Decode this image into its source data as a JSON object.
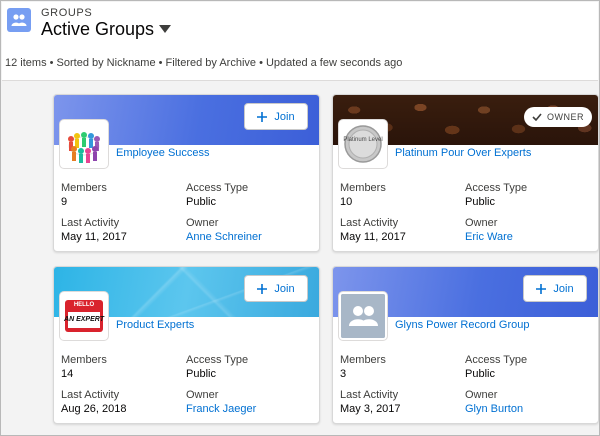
{
  "header": {
    "object_label": "GROUPS",
    "list_title": "Active Groups",
    "meta": "12 items • Sorted by Nickname • Filtered by Archive • Updated a few seconds ago"
  },
  "labels": {
    "members": "Members",
    "access_type": "Access Type",
    "last_activity": "Last Activity",
    "owner": "Owner",
    "join": "Join",
    "owner_badge": "OWNER"
  },
  "cards": [
    {
      "name": "Employee Success",
      "members": "9",
      "access_type": "Public",
      "last_activity": "May 11, 2017",
      "owner": "Anne Schreiner",
      "banner": "blue",
      "action": "join",
      "avatar_icon": "people-circle-image"
    },
    {
      "name": "Platinum Pour Over Experts",
      "members": "10",
      "access_type": "Public",
      "last_activity": "May 11, 2017",
      "owner": "Eric Ware",
      "banner": "coffee",
      "action": "owner",
      "avatar_icon": "platinum-level-medal-image",
      "avatar_text": "Platinum Level"
    },
    {
      "name": "Product Experts",
      "members": "14",
      "access_type": "Public",
      "last_activity": "Aug 26, 2018",
      "owner": "Franck Jaeger",
      "banner": "cyan",
      "action": "join",
      "avatar_icon": "hello-name-tag-image",
      "avatar_text_top": "HELLO",
      "avatar_text_bottom": "AN EXPERT"
    },
    {
      "name": "Glyns Power Record Group",
      "members": "3",
      "access_type": "Public",
      "last_activity": "May 3, 2017",
      "owner": "Glyn Burton",
      "banner": "blue",
      "action": "join",
      "avatar_icon": "group-people-icon"
    }
  ],
  "colors": {
    "link": "#0070d2",
    "header_icon_bg": "#779ef2",
    "group_avatar_bg": "#a8b7c7"
  }
}
